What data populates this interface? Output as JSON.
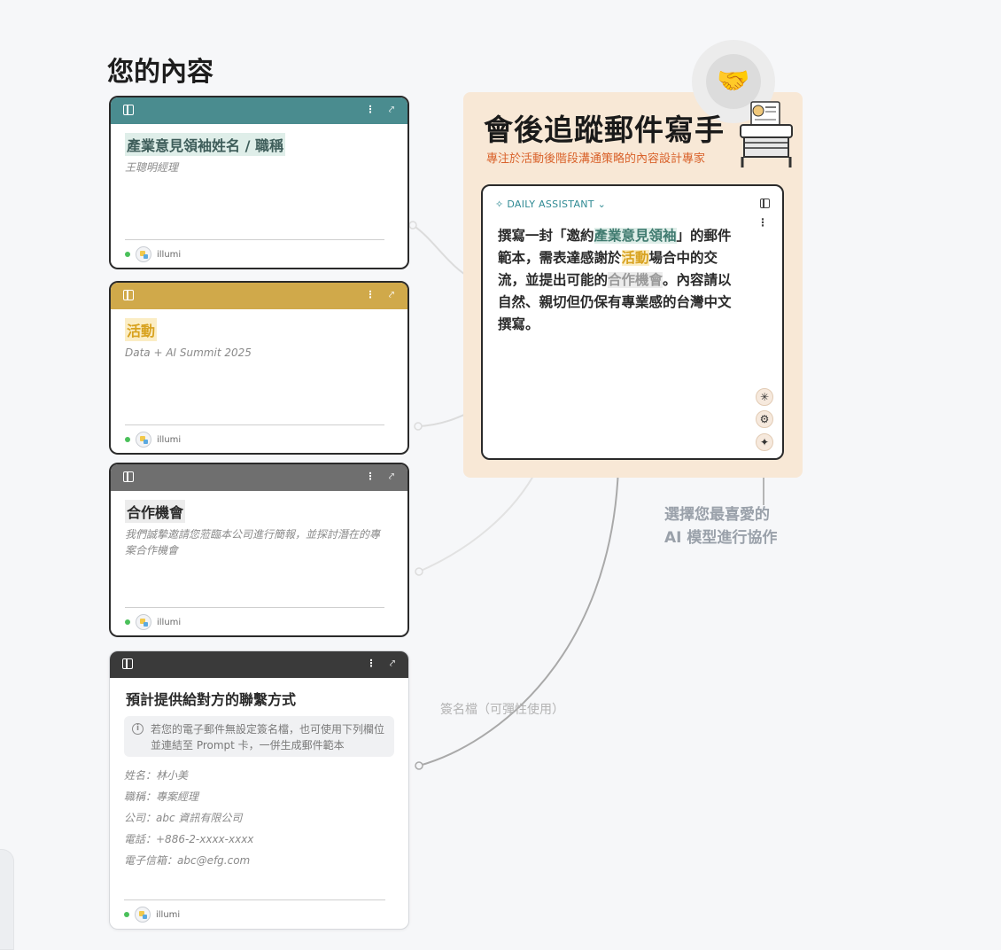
{
  "section_title": "您的內容",
  "cards": [
    {
      "title": "產業意見領袖姓名 / 職稱",
      "value": "王聰明經理",
      "user": "illumi",
      "header_color": "#4a8c8f",
      "title_highlight": "#dfeee9",
      "title_color": "#3e5d5a"
    },
    {
      "title": "活動",
      "value": "Data + AI Summit 2025",
      "user": "illumi",
      "header_color": "#d0a94a",
      "title_highlight": "#fbedc4",
      "title_color": "#d8a21f"
    },
    {
      "title": "合作機會",
      "value": "我們誠摯邀請您蒞臨本公司進行簡報，並探討潛在的專案合作機會",
      "user": "illumi",
      "header_color": "#6f6f6f",
      "title_highlight": "#ececec",
      "title_color": "#2a2a2a"
    },
    {
      "title": "預計提供給對方的聯繫方式",
      "notice": "若您的電子郵件無設定簽名檔，也可使用下列欄位並連結至 Prompt 卡，一併生成郵件範本",
      "contact_lines": [
        "姓名：林小美",
        "職稱：專案經理",
        "公司：abc 資訊有限公司",
        "電話：+886-2-xxxx-xxxx",
        "電子信箱：abc@efg.com"
      ],
      "user": "illumi",
      "header_color": "#3a3a3a"
    }
  ],
  "prompt_card": {
    "title": "會後追蹤郵件寫手",
    "subtitle": "專注於活動後階段溝通策略的內容設計專家",
    "assistant_tag": "DAILY ASSISTANT",
    "prompt_parts": {
      "p1": "撰寫一封「邀約",
      "h1": "產業意見領袖",
      "p2": "」的郵件範本，需表達感謝於",
      "h2": "活動",
      "p3": "場合中的交流，並提出可能的",
      "h3": "合作機會",
      "p4": "。內容請以自然、親切但仍保有專業感的台灣中文撰寫。"
    },
    "model_icons": [
      "claude-icon",
      "openai-icon",
      "gemini-icon"
    ],
    "panel_color": "#f8e8d6",
    "emoji": "🤝"
  },
  "annotation": [
    "選擇您最喜愛的",
    "AI 模型進行協作"
  ],
  "signature_label": "簽名檔（可彈性使用）"
}
